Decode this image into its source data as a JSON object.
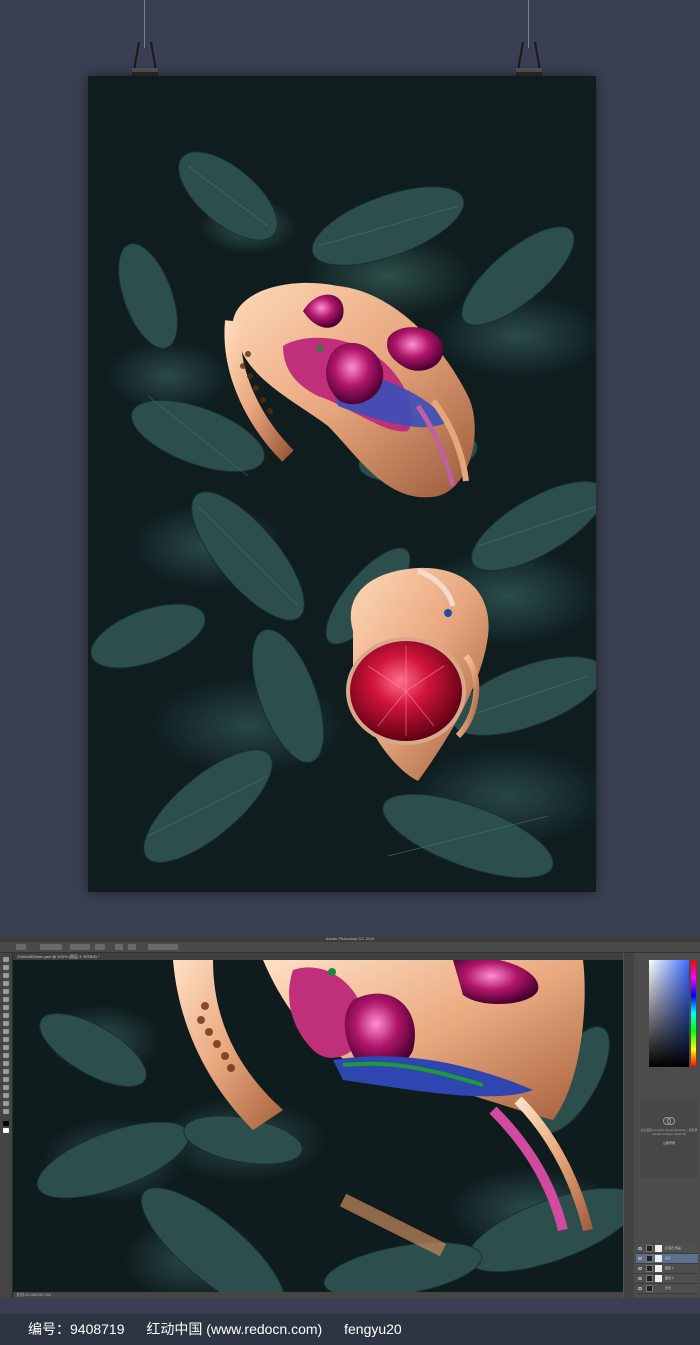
{
  "photoshop": {
    "app_title": "Adobe Photoshop CC 2015",
    "doc_tab": "2040x3853mm.psd @ 100% (图层 3, RGB/8) *",
    "status": "文档:40.0M/467.2M",
    "cc_text": "这在使用 Creative Cloud Libraries，请登录 Adobe Creative Cloud 中",
    "cc_button": "立即登录",
    "layers": [
      {
        "name": "红宝石 饰品"
      },
      {
        "name": "钻石"
      },
      {
        "name": "图层 1"
      },
      {
        "name": "图层 2"
      },
      {
        "name": "背景"
      }
    ]
  },
  "footer": {
    "id_label": "编号：9408719",
    "site": "红动中国 (www.redocn.com)",
    "author": "fengyu20"
  },
  "colors": {
    "background": "#3a4052",
    "footer_bg": "#2f3442",
    "ruby": "#b3102c",
    "rose_gold": "#e7a57c"
  }
}
